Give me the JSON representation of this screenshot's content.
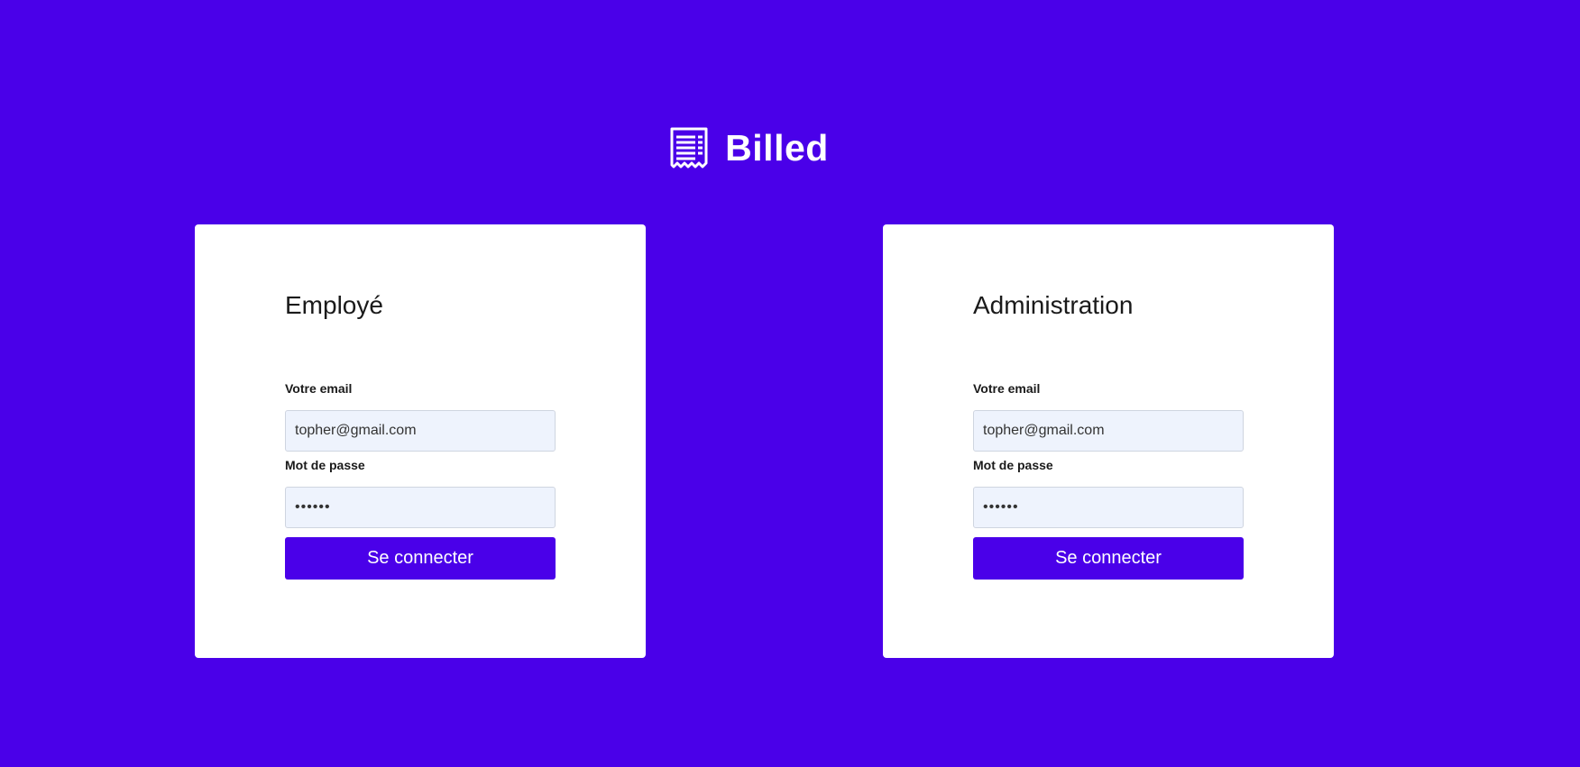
{
  "app": {
    "title": "Billed",
    "logo_icon": "receipt-icon"
  },
  "colors": {
    "background": "#4a00e9",
    "card": "#ffffff",
    "input_background": "#eef3fd",
    "button": "#4a00e9"
  },
  "employee_card": {
    "title": "Employé",
    "email_label": "Votre email",
    "email_value": "topher@gmail.com",
    "password_label": "Mot de passe",
    "password_value": "••••••",
    "submit_label": "Se connecter"
  },
  "admin_card": {
    "title": "Administration",
    "email_label": "Votre email",
    "email_value": "topher@gmail.com",
    "password_label": "Mot de passe",
    "password_value": "••••••",
    "submit_label": "Se connecter"
  }
}
